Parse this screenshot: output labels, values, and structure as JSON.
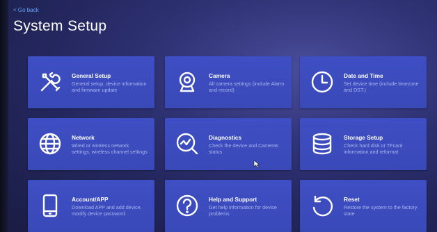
{
  "nav": {
    "back_label": "< Go back"
  },
  "page": {
    "title": "System Setup"
  },
  "tiles": [
    {
      "icon": "tools-icon",
      "title": "General Setup",
      "description": "General setup, device information and firmware update"
    },
    {
      "icon": "camera-icon",
      "title": "Camera",
      "description": "All camera settings (include Alarm and record)"
    },
    {
      "icon": "clock-icon",
      "title": "Date and Time",
      "description": "Set device time (include timezone and DST.)"
    },
    {
      "icon": "globe-icon",
      "title": "Network",
      "description": "Wired or wireless network settings, wireless channel settings"
    },
    {
      "icon": "diagnostics-icon",
      "title": "Diagnostics",
      "description": "Check the device and Cameras status"
    },
    {
      "icon": "database-icon",
      "title": "Storage Setup",
      "description": "Check hard disk or TFcard information and reformat"
    },
    {
      "icon": "phone-icon",
      "title": "Account/APP",
      "description": "Download APP and add device, modify device password"
    },
    {
      "icon": "help-icon",
      "title": "Help and Support",
      "description": "Get help information for device problems"
    },
    {
      "icon": "reset-icon",
      "title": "Reset",
      "description": "Restore the system to the factory state"
    }
  ],
  "colors": {
    "tile": "#3e4fc4",
    "background": "#2f3274",
    "link": "#5fa8ff"
  }
}
